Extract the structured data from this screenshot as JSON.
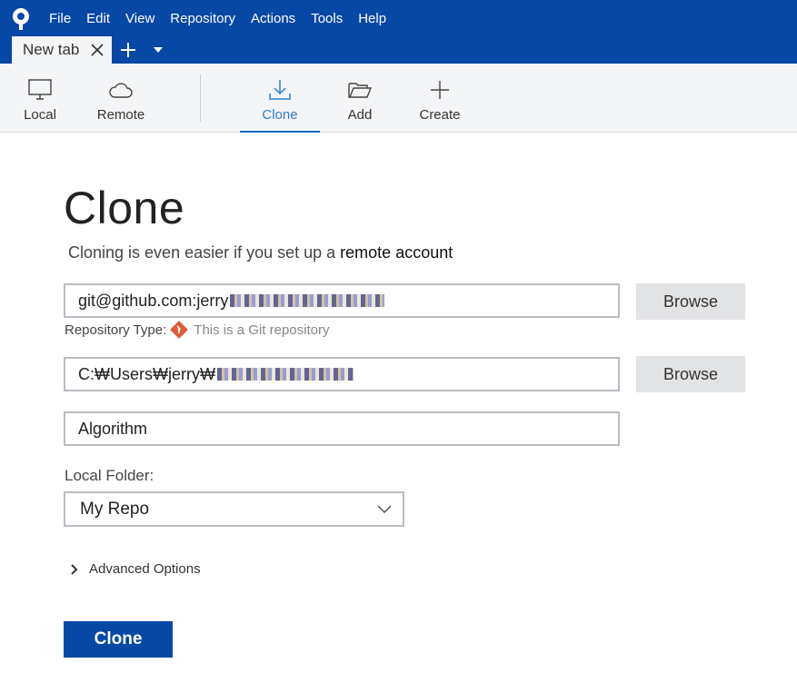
{
  "menu": {
    "items": [
      "File",
      "Edit",
      "View",
      "Repository",
      "Actions",
      "Tools",
      "Help"
    ]
  },
  "tabs": [
    {
      "label": "New tab",
      "icon": "close-icon"
    }
  ],
  "toolbar": {
    "items": [
      {
        "label": "Local",
        "icon": "monitor-icon"
      },
      {
        "label": "Remote",
        "icon": "cloud-icon"
      },
      {
        "label": "Clone",
        "icon": "download-icon",
        "active": true
      },
      {
        "label": "Add",
        "icon": "folder-open-icon"
      },
      {
        "label": "Create",
        "icon": "plus-icon"
      }
    ]
  },
  "main": {
    "title": "Clone",
    "subtitle_prefix": "Cloning is even easier if you set up a ",
    "subtitle_link": "remote account",
    "source_url": "git@github.com:jerry",
    "destination_path": "C:₩Users₩jerry₩",
    "name": "Algorithm",
    "browse_label": "Browse",
    "repo_type_label": "Repository Type:",
    "repo_type_value": "This is a Git repository",
    "local_folder_label": "Local Folder:",
    "local_folder_value": "My Repo",
    "advanced_options_label": "Advanced Options",
    "clone_button_label": "Clone"
  },
  "colors": {
    "brand": "#0747a6",
    "active_tab_text": "#2f7dd1",
    "git_icon": "#e15a3a"
  }
}
